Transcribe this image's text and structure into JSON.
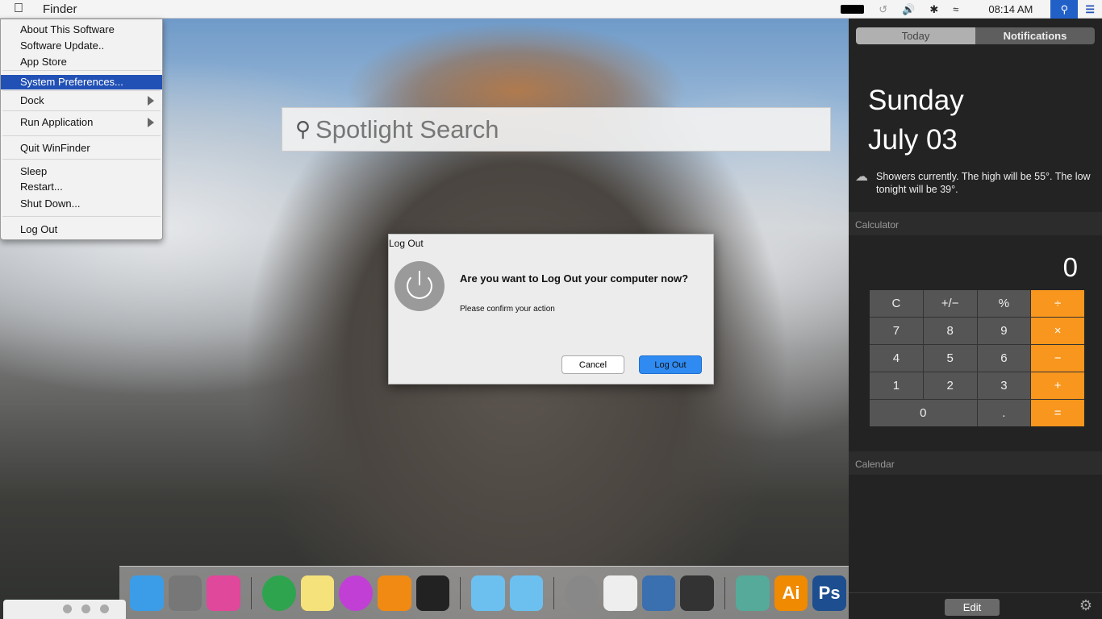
{
  "menubar": {
    "app": "Finder",
    "time": "08:14 AM"
  },
  "menu": {
    "items": [
      {
        "label": "About This Software"
      },
      {
        "label": "Software Update.."
      },
      {
        "label": "App Store"
      },
      {
        "label": "System Preferences...",
        "selected": true
      },
      {
        "label": "Dock",
        "submenu": true
      },
      {
        "label": "Run Application",
        "submenu": true
      },
      {
        "label": "Quit WinFinder"
      },
      {
        "label": "Sleep"
      },
      {
        "label": "Restart..."
      },
      {
        "label": "Shut Down..."
      },
      {
        "label": "Log Out"
      }
    ]
  },
  "spotlight": {
    "placeholder": "Spotlight Search"
  },
  "dialog": {
    "title": "Log Out",
    "question": "Are you want to Log Out your computer now?",
    "subtitle": "Please confirm your action",
    "cancel": "Cancel",
    "confirm": "Log Out"
  },
  "notification_center": {
    "tabs": [
      "Today",
      "Notifications"
    ],
    "day": "Sunday",
    "date": "July 03",
    "weather": "Showers currently. The high will be 55°. The low tonight will be 39°.",
    "calculator_title": "Calculator",
    "display": "0",
    "keys": [
      "C",
      "+/−",
      "%",
      "÷",
      "7",
      "8",
      "9",
      "×",
      "4",
      "5",
      "6",
      "−",
      "1",
      "2",
      "3",
      "+",
      "0",
      ".",
      "="
    ],
    "calendar_title": "Calendar",
    "edit": "Edit"
  },
  "dock": {
    "apps": [
      "finder",
      "system-preferences",
      "game-center",
      "chrome",
      "notes",
      "itunes",
      "vlc",
      "music-app",
      "folder",
      "applications-folder",
      "power",
      "task-list",
      "laptop",
      "activity-monitor",
      "maps",
      "illustrator",
      "photoshop"
    ],
    "labels": {
      "illustrator": "Ai",
      "photoshop": "Ps"
    }
  },
  "colors": {
    "accent": "#2251b6",
    "calc_operator": "#f8961d",
    "confirm_button": "#2f8bf2"
  }
}
